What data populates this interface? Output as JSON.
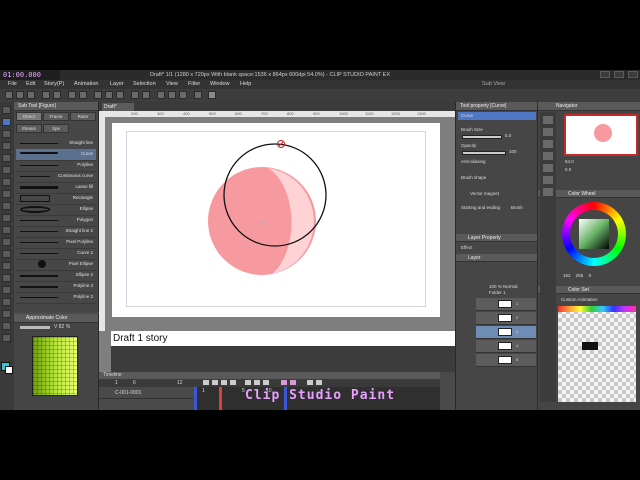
{
  "window": {
    "timecode": "01:00.000",
    "title": "Draft* 1/1 (1280 x 720px With blank space:1536 x 864px 600dpi 54.0%) - CLIP STUDIO PAINT EX",
    "subview_label": "Sub View"
  },
  "menu": [
    "File",
    "Edit",
    "Story(P)",
    "Animation",
    "Layer",
    "Selection",
    "View",
    "Filter",
    "Window",
    "Help"
  ],
  "doc_tab": "Draft*",
  "subtool": {
    "title": "Sub Tool [Figure]",
    "tabs": [
      "Direct",
      "Frame",
      "Ruler",
      "Stream",
      "Spe"
    ],
    "items": [
      "Straight line",
      "Curve",
      "Polyline",
      "Continuous curve",
      "Lasso fill",
      "Rectangle",
      "Ellipse",
      "Polygon",
      "Straight line 2",
      "Pixel Polyline",
      "Curve 2",
      "Pixel Ellipse",
      "Ellipse 2",
      "Polyline 3",
      "Polyline 2"
    ],
    "selected": "Curve"
  },
  "color_panel": {
    "title": "Approximate Color",
    "v_label": "V",
    "v_value": "82",
    "v_unit": "%"
  },
  "canvas": {
    "ruler_marks": [
      "200",
      "300",
      "400",
      "500",
      "600",
      "700",
      "800",
      "900",
      "1000",
      "1100",
      "1200",
      "1300"
    ],
    "story_text": "Draft 1 story"
  },
  "timeline": {
    "title": "Timeline",
    "track_name": "C-001-0001",
    "rows": [
      "Folder 1",
      "Paper"
    ],
    "frame_numbers": [
      "1",
      "6",
      "12"
    ],
    "ruler_numbers": [
      "1",
      "5",
      "10"
    ],
    "cel_labels": [
      "1",
      "2"
    ]
  },
  "tool_property": {
    "title": "Tool property [Curve]",
    "tool_name": "Curve",
    "brush_size_label": "Brush Size",
    "brush_size_value": "5.0",
    "opacity_label": "Opacity",
    "opacity_value": "100",
    "aa_label": "Anti-aliasing",
    "shape_label": "Brush shape",
    "vector_label": "Vector magnet",
    "ends_label": "Starting and ending",
    "ends_value": "Brush"
  },
  "layers": {
    "layer_property_title": "Layer Property",
    "effect_label": "Effect",
    "title": "Layer",
    "blend": "100 % Normal",
    "folder": "Folder 1",
    "layer_names": [
      "1",
      "2",
      "3",
      "4",
      "5"
    ],
    "cel_badges": [
      "100",
      "100"
    ]
  },
  "navigator": {
    "title": "Navigator",
    "zoom": "54.0",
    "angle": "0.0"
  },
  "color_wheel": {
    "title": "Color Wheel",
    "h": "162",
    "s": "255",
    "v": "0"
  },
  "color_set": {
    "title": "Color Set",
    "name": "Custom Animation"
  },
  "colors": {
    "circle_fill": "#f79aa0",
    "circle_shade": "#ffd2d6",
    "wheel_square": "#66b466"
  },
  "bottom_title": "Clip Studio Paint"
}
